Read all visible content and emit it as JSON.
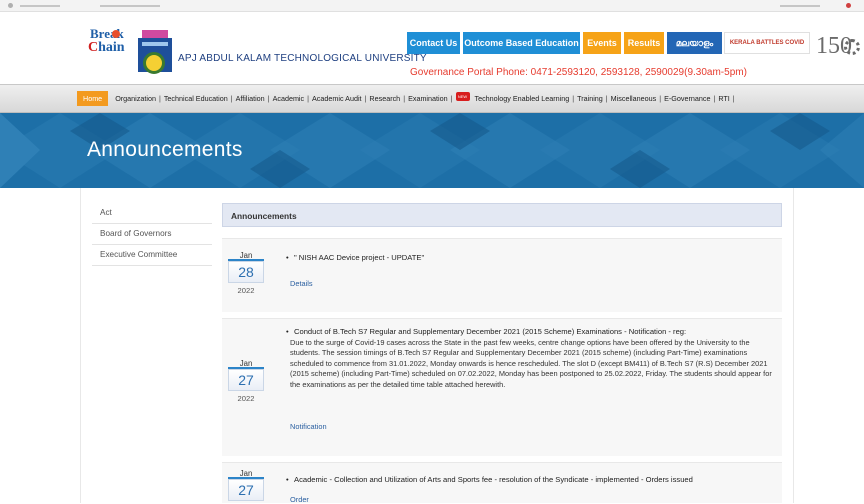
{
  "header": {
    "logo_break_line1": "Break",
    "logo_break_line2a": "C",
    "logo_break_line2b": "hain",
    "university_name": "APJ ABDUL KALAM TECHNOLOGICAL UNIVERSITY",
    "buttons": [
      {
        "label": "Contact Us"
      },
      {
        "label": "Outcome Based Education"
      },
      {
        "label": "Events"
      },
      {
        "label": "Results"
      },
      {
        "label": "മലയാളം"
      },
      {
        "label": "KERALA BATTLES COVID"
      }
    ],
    "portal_text": "Governance Portal Phone: 0471-2593120, 2593128, 2590029(9.30am-5pm)",
    "anniversary_number": "150"
  },
  "nav": {
    "home": "Home",
    "items": [
      "Organization",
      "Technical Education",
      "Affiliation",
      "Academic",
      "Academic Audit",
      "Research",
      "Examination",
      "Technology Enabled Learning",
      "Training",
      "Miscellaneous",
      "E-Governance",
      "RTI"
    ],
    "new_badge": "NEW"
  },
  "banner": {
    "title": "Announcements"
  },
  "sidebar": {
    "items": [
      {
        "label": "Act"
      },
      {
        "label": "Board of Governors"
      },
      {
        "label": "Executive Committee"
      }
    ]
  },
  "announcements_header": "Announcements",
  "announcements": [
    {
      "month": "Jan",
      "day": "28",
      "year": "2022",
      "title": "\" NISH AAC Device project - UPDATE\"",
      "body": "",
      "link": "Details"
    },
    {
      "month": "Jan",
      "day": "27",
      "year": "2022",
      "title": "Conduct of B.Tech S7 Regular and Supplementary December 2021 (2015 Scheme) Examinations - Notification - reg:",
      "body": "Due to the surge of Covid-19 cases across the State in the past few weeks, centre change options have been offered by the University to the students. The session timings of B.Tech S7 Regular and Supplementary December 2021 (2015 scheme) (including Part-Time) examinations scheduled to commence from 31.01.2022, Monday onwards is hence rescheduled. The slot D (except BM411) of B.Tech S7 (R.S) December 2021 (2015 scheme) (including Part-Time) scheduled on 07.02.2022, Monday has been postponed to 25.02.2022, Friday. The students should appear for the examinations as per the detailed time table attached herewith.",
      "link": "Notification"
    },
    {
      "month": "Jan",
      "day": "27",
      "year": "",
      "title": "Academic - Collection and Utilization of Arts and Sports fee - resolution of the Syndicate - implemented - Orders issued",
      "body": "",
      "link": "Order"
    }
  ],
  "colors": {
    "banner_bg": "#1d6fa7",
    "nav_home_bg": "#f39a1f",
    "portal_text": "#e63b2e",
    "date_accent": "#2c84c8"
  }
}
